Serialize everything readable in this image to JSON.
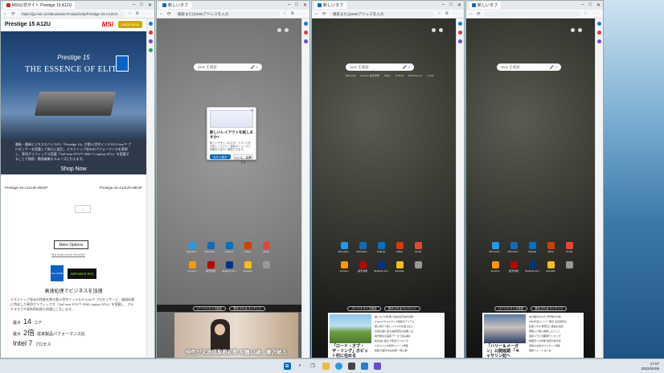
{
  "windows": [
    {
      "tab_title": "MSI公式サイト Prestige 15 A12U",
      "url": "https://jp.msi.com/Business-Productivity/Prestige-15-A12UX",
      "page": {
        "header_title": "Prestige 15 A12U",
        "logo": "MSI",
        "buy_label": "SHOP NOW",
        "hero_line1": "Prestige 15",
        "hero_line2": "THE ESSENCE OF ELITE",
        "description": "最新・最新ビジネスモバイルPC「Prestige 15」が第12世代インテル® Core™ プロセッサーを搭載して新たに誕生。デスクトップ並みのパフォーマンスを実現し、専用グラフィックス搭載「GeForce RTX™ 3050 Ti Laptop GPU」を搭載することで描画・動画編集もスムーズに行えます。",
        "shop_now": "Shop Now",
        "model_left": "Prestige-15-A12UD-080JP",
        "model_right": "Prestige-15-A12UD-090JP",
        "more_options": "More Options",
        "authorized": "Msi Authorized Reseller",
        "badge_intel": "intel CORE",
        "badge_rtx": "GEFORCE RTX",
        "perf_heading": "高速処理でビジネスを加速",
        "perf_text": "デスクトップ並みの性能を誇る第12世代インテル® Core™ プロセッサーと、描画処理に特化した専用グラフィックス「GeForce RTX™ 3050 Laptop GPU」を搭載し、マルチタスクや高負荷処理も快適にこなします。",
        "spec1_label": "最大",
        "spec1_value": "14",
        "spec1_unit": "コア",
        "spec2_label": "最大",
        "spec2_value": "2倍",
        "spec2_unit": "従来製品パフォーマンス比",
        "spec3_value": "Intel 7",
        "spec3_unit": "プロセス"
      }
    },
    {
      "tab_title": "新しいタブ",
      "url": "検索またはWebアドレスを入力",
      "search_placeholder": "Web を検索",
      "popup": {
        "title": "新しいレイアウトを試しますか?",
        "body": "新しいデザインのスタートページをお試しください。最新のニュースと情報をすばやく確認できます。",
        "primary": "今すぐ試す",
        "secondary": "いいえ、結構です"
      },
      "quick_links": [
        "Microsoft...",
        "Microsoft...",
        "Outlook",
        "Office",
        "Gmail",
        "Amazon",
        "楽天市場",
        "Booking.com",
        "Expedia",
        ""
      ],
      "feed_pills": [
        "パーソナライズ設定",
        "表示されるコンテンツ"
      ],
      "video_caption": "仲色が女流棋聖戦初戦 昭鶴13歳、藤沢破る"
    },
    {
      "tab_title": "新しいタブ",
      "url": "検索またはWebアドレスを入力",
      "search_placeholder": "Web を検索",
      "quick_links": [
        "Microsoft...",
        "Microsoft...",
        "Outlook",
        "Office",
        "Gmail",
        "Amazon",
        "楽天市場",
        "Booking.com",
        "Expedia",
        ""
      ],
      "shortcut_row": [
        "Microsoft",
        "Amazon 楽天市場",
        "Office",
        "Outlook",
        "Booking.com",
        "Gmail"
      ],
      "feed_pills": [
        "パーソナライズ設定",
        "表示されるコンテンツ"
      ],
      "card_title": "「ロード・オブ・ザ・リング」ホビット村に住める",
      "news_lines": [
        "巣ごもりの影響で過去最高益を記録",
        "Amazonやメルカリで話題のアイテム",
        "夏に向けて新しいスマホを選ぶなら",
        "宇宙の謎に迫る最新研究の成果とは",
        "地方移住の実態 データで読み解く",
        "新生活に役立つ家電ランキング",
        "人気カフェの新作スイーツ特集",
        "株価 日経平均は続伸 一時上昇"
      ]
    },
    {
      "tab_title": "新しいタブ",
      "url": "",
      "search_placeholder": "Web を検索",
      "quick_links": [
        "Microsoft...",
        "Microsoft...",
        "Outlook",
        "Office",
        "Gmail",
        "Amazon",
        "楽天市場",
        "Booking.com",
        "Expedia",
        ""
      ],
      "feed_pills": [
        "パーソナライズ設定",
        "表示されるコンテンツ"
      ],
      "card_title": "「ハリー＆メーガン」公開延期 「キャサリン妃へ",
      "news_lines": [
        "地方経済の行方 専門家が分析",
        "WBC代表メンバー発表 注目選手は",
        "新型スマホ 発売日と価格が決定",
        "梅雨入り前に確認したいこと",
        "最新ドラマ 視聴率ランキング",
        "物価高への対策 政府が新方針",
        "週末のお出かけスポット特集",
        "国際ニュース まとめ"
      ]
    }
  ],
  "taskbar": {
    "time": "17:07",
    "date": "2022/06/06"
  }
}
